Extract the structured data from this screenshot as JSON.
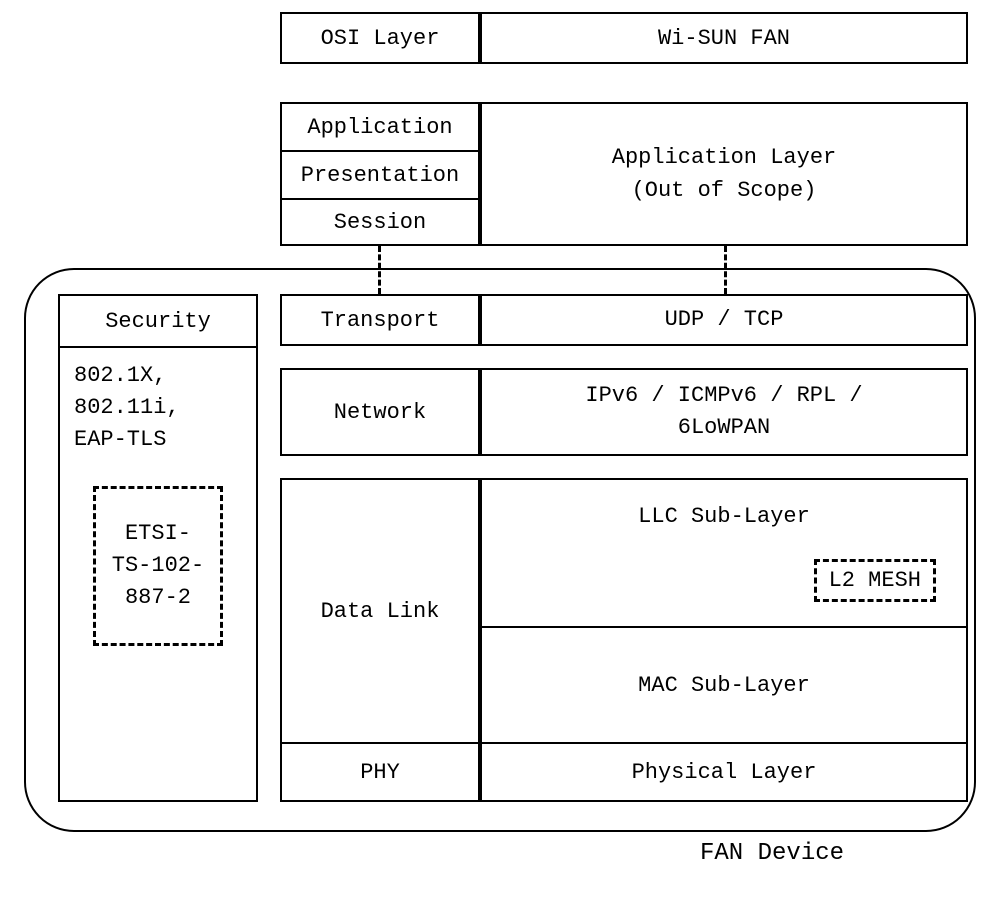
{
  "header": {
    "osi_label": "OSI Layer",
    "wisun_label": "Wi-SUN FAN"
  },
  "application_block": {
    "osi_layers": [
      "Application",
      "Presentation",
      "Session"
    ],
    "wisun_label": "Application Layer\n(Out of Scope)"
  },
  "fan_device_label": "FAN Device",
  "security": {
    "title": "Security",
    "items": "802.1X,\n802.11i,\nEAP-TLS",
    "etsi": "ETSI-\nTS-102-\n887-2"
  },
  "layers": {
    "transport": {
      "osi": "Transport",
      "wisun": "UDP / TCP"
    },
    "network": {
      "osi": "Network",
      "wisun": "IPv6 / ICMPv6 / RPL /\n6LoWPAN"
    },
    "datalink": {
      "osi": "Data Link",
      "llc": "LLC Sub-Layer",
      "l2mesh": "L2 MESH",
      "mac": "MAC Sub-Layer"
    },
    "phy": {
      "osi": "PHY",
      "wisun": "Physical Layer"
    }
  }
}
